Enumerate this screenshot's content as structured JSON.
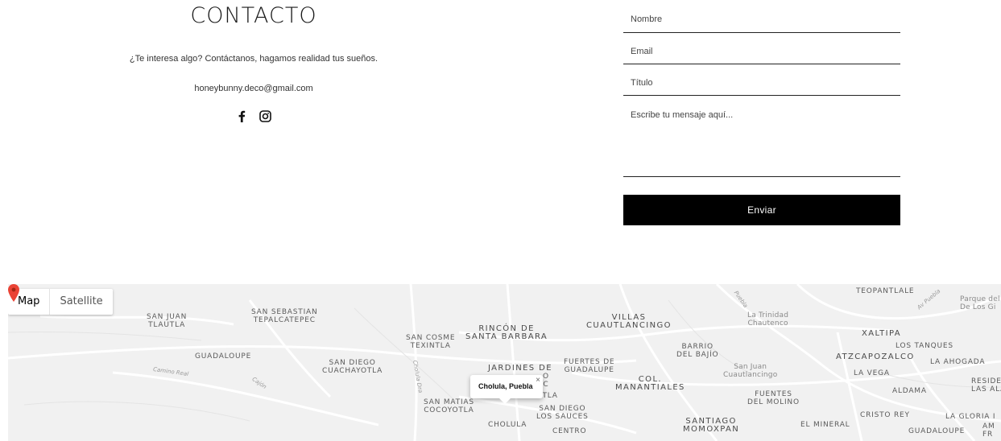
{
  "contact": {
    "title": "CONTACTO",
    "tagline": "¿Te interesa algo?  Contáctanos, hagamos realidad tus sueños.",
    "email": "honeybunny.deco@gmail.com",
    "social_icons": [
      "facebook-icon",
      "instagram-icon"
    ]
  },
  "form": {
    "name_placeholder": "Nombre",
    "email_placeholder": "Email",
    "title_placeholder": "Título",
    "message_placeholder": "Escribe tu mensaje aquí...",
    "submit_label": "Enviar",
    "button_color": "#000000"
  },
  "map": {
    "type_map": "Map",
    "type_satellite": "Satellite",
    "popup_text": "Cholula, Puebla",
    "popup_close": "×",
    "marker_color": "#ea4335",
    "labels": {
      "san_juan_tlautla": "SAN JUAN\nTLAUTLA",
      "san_sebastian": "SAN SEBASTIAN\nTEPALCATEPEC",
      "guadaloupe_left": "GUADALOUPE",
      "san_diego_cuachayotla": "SAN DIEGO\nCUACHAYOTLA",
      "san_cosme": "SAN COSME\nTEXINTLA",
      "rincon": "RINCÓN DE\nSANTA BARBARA",
      "villas": "VILLAS\nCUAUTLANCINGO",
      "barrio_bajio": "BARRIO\nDEL BAJÍO",
      "trinidad": "La Trinidad\nChautenco",
      "teopantlale": "TEOPANTLALE",
      "parque": "Parque del\nDe Los Gi",
      "xaltipa": "XALTIPA",
      "los_tanques": "LOS TANQUES",
      "atzcapozalco": "ATZCAPOZALCO",
      "la_ahogada": "LA AHOGADA",
      "la_vega": "LA VEGA",
      "aldama": "ALDAMA",
      "reside": "RESIDE\nLAS ALA",
      "jardines": "JARDINES DE",
      "fuertes": "FUERTES DE\nGUADALUPE",
      "san_juan_cuautlancingo": "San Juan\nCuautlancingo",
      "col_manantiales": "COL.\nMANANTIALES",
      "fuentes_molino": "FUENTES\nDEL MOLINO",
      "san_matias": "SAN MATIAS\nCOCOYOTLA",
      "san_diego_sauces": "SAN DIEGO\nLOS SAUCES",
      "cholula": "CHOLULA",
      "centro": "CENTRO",
      "santiago": "SANTIAGO\nMOMOXPAN",
      "el_mineral": "EL MINERAL",
      "cristo_rey": "CRISTO REY",
      "la_gloria": "LA GLORIA I",
      "guadaloupe_right": "GUADALOUPE",
      "am_fr": "AM\nFR",
      "camino_real": "Camino Real",
      "cajon": "Cajón",
      "cholula_dra": "Cholula Dra",
      "av_puebla": "Av Puebla",
      "puebla_road": "Puebla",
      "itla": "ITLA",
      "o_c": "O\nC"
    }
  }
}
